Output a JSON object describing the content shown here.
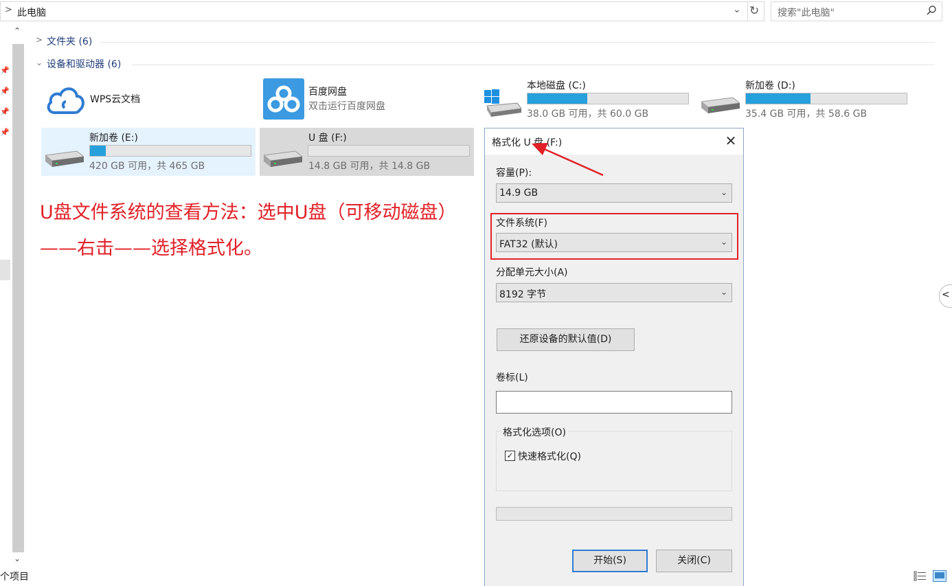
{
  "address": {
    "path": "此电脑"
  },
  "search": {
    "placeholder": "搜索\"此电脑\""
  },
  "sections": {
    "folders": "文件夹 (6)",
    "devices": "设备和驱动器 (6)"
  },
  "drives": [
    {
      "name": "WPS云文档",
      "sub": ""
    },
    {
      "name": "百度网盘",
      "sub": "双击运行百度网盘"
    },
    {
      "name": "本地磁盘 (C:)",
      "sub": "38.0 GB 可用，共 60.0 GB",
      "used_fraction": 0.37
    },
    {
      "name": "新加卷 (D:)",
      "sub": "35.4 GB 可用，共 58.6 GB",
      "used_fraction": 0.4
    },
    {
      "name": "新加卷 (E:)",
      "sub": "420 GB 可用，共 465 GB",
      "used_fraction": 0.1
    },
    {
      "name": "U 盘 (F:)",
      "sub": "14.8 GB 可用，共 14.8 GB",
      "used_fraction": 0.0
    }
  ],
  "annotation": "U盘文件系统的查看方法：选中U盘（可移动磁盘）——右击——选择格式化。",
  "dialog": {
    "title": "格式化 U 盘 (F:)",
    "capacity_label": "容量(P):",
    "capacity_value": "14.9 GB",
    "fs_label": "文件系统(F)",
    "fs_value": "FAT32 (默认)",
    "alloc_label": "分配单元大小(A)",
    "alloc_value": "8192 字节",
    "restore_button": "还原设备的默认值(D)",
    "volume_label": "卷标(L)",
    "volume_value": "",
    "options_label": "格式化选项(O)",
    "quick_format": "快速格式化(Q)",
    "quick_format_checked": true,
    "start_button": "开始(S)",
    "close_button": "关闭(C)"
  },
  "status": {
    "items_text": "个项目"
  },
  "colors": {
    "accent": "#26a0da",
    "annotation_red": "#e12027"
  }
}
